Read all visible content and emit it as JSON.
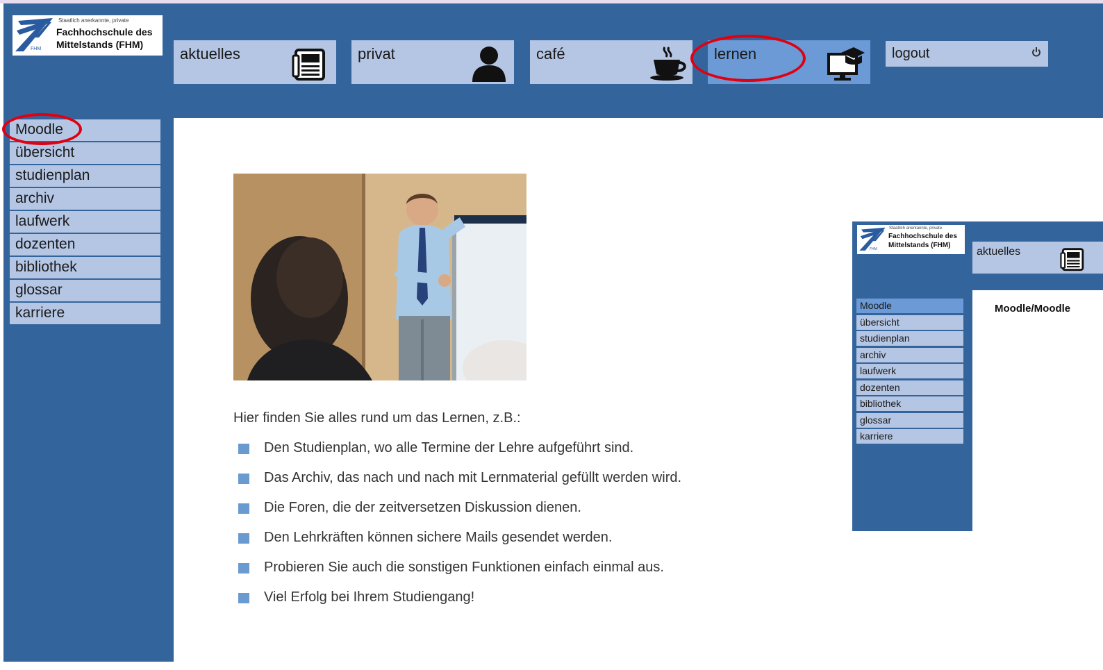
{
  "logo": {
    "line1": "Staatlich anerkannte, private",
    "line2": "Fachhochschule des",
    "line3": "Mittelstands (FHM)",
    "abbr": "FHM"
  },
  "nav": {
    "tabs": [
      {
        "label": "aktuelles",
        "icon": "newspaper-icon"
      },
      {
        "label": "privat",
        "icon": "person-icon"
      },
      {
        "label": "café",
        "icon": "coffee-cup-icon"
      },
      {
        "label": "lernen",
        "icon": "graduation-monitor-icon",
        "active": true
      }
    ],
    "logout": {
      "label": "logout",
      "icon": "power-icon"
    }
  },
  "sidebar": {
    "items": [
      "Moodle",
      "übersicht",
      "studienplan",
      "archiv",
      "laufwerk",
      "dozenten",
      "bibliothek",
      "glossar",
      "karriere"
    ]
  },
  "main": {
    "intro": "Hier finden Sie alles rund um das Lernen, z.B.:",
    "bullets": [
      "Den Studienplan, wo alle Termine der Lehre aufgeführt sind.",
      "Das Archiv, das nach und nach mit Lernmaterial gefüllt werden wird.",
      "Die Foren, die der zeitversetzen Diskussion dienen.",
      "Den Lehrkräften können sichere Mails gesendet werden.",
      "Probieren Sie auch die sonstigen Funktionen einfach einmal aus.",
      "Viel Erfolg bei Ihrem Studiengang!"
    ]
  },
  "preview": {
    "tab_label": "aktuelles",
    "title": "Moodle/Moodle",
    "items": [
      "Moodle",
      "übersicht",
      "studienplan",
      "archiv",
      "laufwerk",
      "dozenten",
      "bibliothek",
      "glossar",
      "karriere"
    ]
  },
  "colors": {
    "header_blue": "#34649c",
    "tab_light": "#b4c6e4",
    "tab_active": "#6b9ad6",
    "highlight_red": "#e00010",
    "bullet_blue": "#6a9bd0"
  }
}
